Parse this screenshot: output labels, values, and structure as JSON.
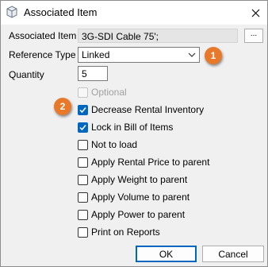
{
  "window": {
    "title": "Associated Item",
    "title_icon": "cube-icon",
    "close_icon": "close-icon"
  },
  "form": {
    "associated_item_label": "Associated Item",
    "associated_item_value": "3G-SDI Cable 75';",
    "browse_label": "...",
    "reference_type_label": "Reference Type",
    "reference_type_value": "Linked",
    "quantity_label": "Quantity",
    "quantity_value": "5"
  },
  "options": [
    {
      "label": "Optional",
      "checked": false,
      "disabled": true
    },
    {
      "label": "Decrease Rental Inventory",
      "checked": true,
      "disabled": false
    },
    {
      "label": "Lock in Bill of Items",
      "checked": true,
      "disabled": false
    },
    {
      "label": "Not to load",
      "checked": false,
      "disabled": false
    },
    {
      "label": "Apply Rental Price to parent",
      "checked": false,
      "disabled": false
    },
    {
      "label": "Apply Weight to parent",
      "checked": false,
      "disabled": false
    },
    {
      "label": "Apply Volume to parent",
      "checked": false,
      "disabled": false
    },
    {
      "label": "Apply Power to parent",
      "checked": false,
      "disabled": false
    },
    {
      "label": "Print on Reports",
      "checked": false,
      "disabled": false
    }
  ],
  "callouts": {
    "first": "1",
    "second": "2",
    "color": "#e8782a"
  },
  "footer": {
    "ok_label": "OK",
    "cancel_label": "Cancel"
  },
  "colors": {
    "accent": "#0067c0",
    "dialog_bg": "#f0f0f0"
  }
}
